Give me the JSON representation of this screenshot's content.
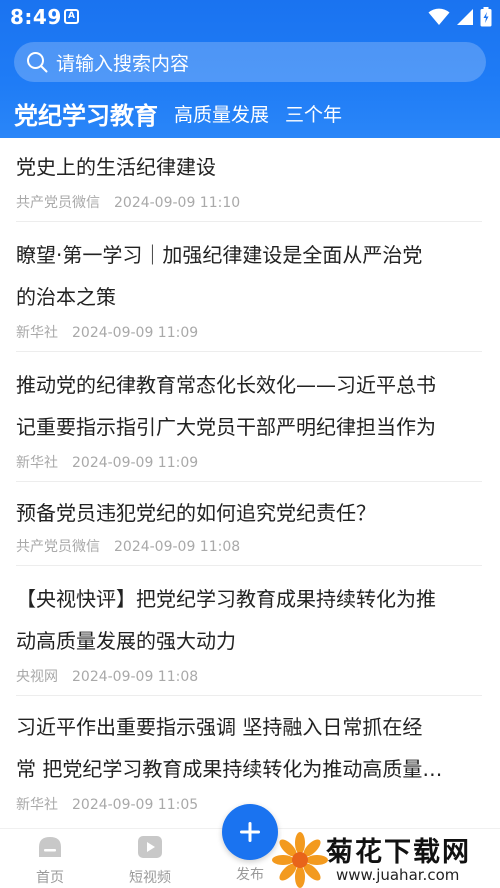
{
  "status_bar": {
    "time": "8:49",
    "app_icon": "A"
  },
  "search": {
    "placeholder": "请输入搜索内容"
  },
  "channels": {
    "main": "党纪学习教育",
    "tabs": [
      "高质量发展",
      "三个年"
    ]
  },
  "articles": [
    {
      "title_lines": [
        "党史上的生活纪律建设"
      ],
      "source": "共产党员微信",
      "time": "2024-09-09 11:10"
    },
    {
      "title_lines": [
        "瞭望·第一学习｜加强纪律建设是全面从严治党",
        "的治本之策"
      ],
      "source": "新华社",
      "time": "2024-09-09 11:09"
    },
    {
      "title_lines": [
        "推动党的纪律教育常态化长效化——习近平总书",
        "记重要指示指引广大党员干部严明纪律担当作为"
      ],
      "source": "新华社",
      "time": "2024-09-09 11:09"
    },
    {
      "title_lines": [
        "预备党员违犯党纪的如何追究党纪责任？"
      ],
      "source": "共产党员微信",
      "time": "2024-09-09 11:08"
    },
    {
      "title_lines": [
        "【央视快评】把党纪学习教育成果持续转化为推",
        "动高质量发展的强大动力"
      ],
      "source": "央视网",
      "time": "2024-09-09 11:08"
    },
    {
      "title_lines": [
        "习近平作出重要指示强调 坚持融入日常抓在经",
        "常 把党纪学习教育成果持续转化为推动高质量…"
      ],
      "source": "新华社",
      "time": "2024-09-09 11:05"
    }
  ],
  "tabbar": {
    "home": "首页",
    "video": "短视频",
    "publish": "发布"
  },
  "watermark": {
    "title": "菊花下载网",
    "url": "www.juahar.com"
  },
  "colors": {
    "brand_blue": "#1a73f0",
    "title_text": "#222222",
    "meta_text": "#a9a9a9"
  },
  "icons": [
    "search-icon",
    "wifi-icon",
    "signal-icon",
    "battery-icon",
    "home-icon",
    "video-icon",
    "plus-icon",
    "chrysanthemum-logo"
  ]
}
